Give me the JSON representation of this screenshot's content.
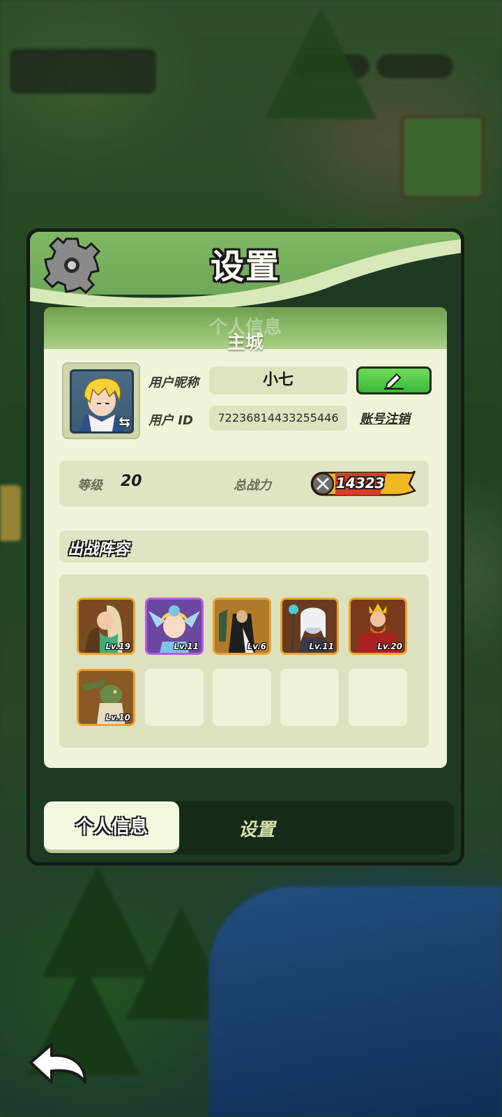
{
  "dialog": {
    "title": "设置",
    "panel_ghost_title": "个人信息",
    "panel_subtitle": "主城"
  },
  "profile": {
    "nickname_label": "用户昵称",
    "nickname_value": "小七",
    "id_label": "用户 ID",
    "id_value": "72236814433255446",
    "cancel_account_label": "账号注销"
  },
  "stats": {
    "level_label": "等级",
    "level_value": "20",
    "power_label": "总战力",
    "power_value": "14323"
  },
  "lineup": {
    "title": "出战阵容",
    "heroes": [
      {
        "level": "Lv.19",
        "frame": "gold"
      },
      {
        "level": "Lv.11",
        "frame": "purple"
      },
      {
        "level": "Lv.6",
        "frame": "gold"
      },
      {
        "level": "Lv.11",
        "frame": "gold"
      },
      {
        "level": "Lv.20",
        "frame": "gold"
      },
      {
        "level": "Lv.10",
        "frame": "gold"
      }
    ],
    "empty_slots": 4
  },
  "tabs": {
    "active": "个人信息",
    "inactive": "设置"
  },
  "colors": {
    "header_green": "#7fb765",
    "panel_bg": "#f1f4da",
    "edit_button": "#3bb83a",
    "gold_frame": "#e8a535",
    "purple_frame": "#b659e3"
  },
  "icons": [
    "gear-icon",
    "edit-pencil-icon",
    "swap-icon",
    "sword-icon",
    "back-arrow-icon"
  ]
}
